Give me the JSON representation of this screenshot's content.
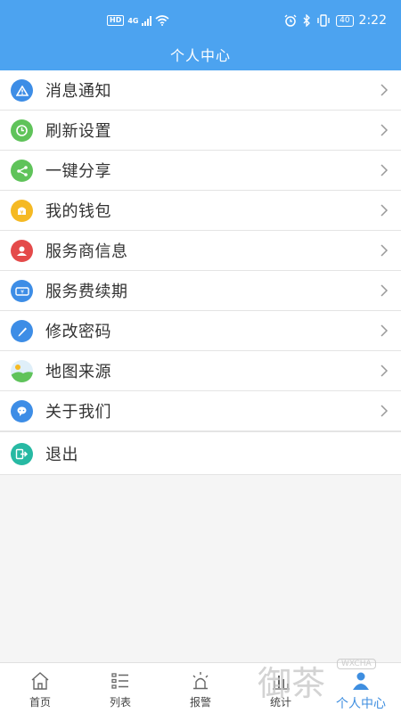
{
  "status_bar": {
    "hd": "HD",
    "network": "4G",
    "battery": "40",
    "time": "2:22"
  },
  "header": {
    "title": "个人中心"
  },
  "menu": {
    "items": [
      {
        "label": "消息通知",
        "icon": "warning-icon",
        "color": "#3d8de6"
      },
      {
        "label": "刷新设置",
        "icon": "clock-icon",
        "color": "#5fc35a"
      },
      {
        "label": "一键分享",
        "icon": "share-icon",
        "color": "#5fc35a"
      },
      {
        "label": "我的钱包",
        "icon": "wallet-icon",
        "color": "#f5b923"
      },
      {
        "label": "服务商信息",
        "icon": "user-icon",
        "color": "#e44a4a"
      },
      {
        "label": "服务费续期",
        "icon": "ticket-icon",
        "color": "#3d8de6"
      },
      {
        "label": "修改密码",
        "icon": "pencil-icon",
        "color": "#3d8de6"
      },
      {
        "label": "地图来源",
        "icon": "map-icon",
        "color": "#5fc35a"
      },
      {
        "label": "关于我们",
        "icon": "chat-icon",
        "color": "#3d8de6"
      }
    ],
    "logout": {
      "label": "退出",
      "icon": "exit-icon",
      "color": "#27b9a3"
    }
  },
  "tabbar": {
    "tabs": [
      {
        "label": "首页",
        "icon": "home-icon"
      },
      {
        "label": "列表",
        "icon": "list-icon"
      },
      {
        "label": "报警",
        "icon": "alarm-icon"
      },
      {
        "label": "统计",
        "icon": "stats-icon"
      },
      {
        "label": "个人中心",
        "icon": "person-icon",
        "active": true
      }
    ]
  },
  "watermark": {
    "text": "御茶",
    "badge": "WXCHA"
  }
}
